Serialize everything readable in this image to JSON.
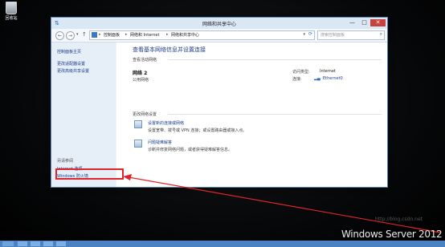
{
  "desktop": {
    "recycle_bin_label": "回收站",
    "watermark": "Windows Server 2012 R",
    "faint_text": "http://blog.csdn.net"
  },
  "window": {
    "title": "网络和共享中心",
    "minimize": "—",
    "maximize": "□",
    "close": "✕"
  },
  "address_bar": {
    "back": "←",
    "forward": "→",
    "history": "▾",
    "up": "↑",
    "breadcrumb": [
      "控制面板",
      "网络和 Internet",
      "网络和共享中心"
    ],
    "separator": "▸",
    "dropdown": "▾",
    "refresh": "⟳",
    "search_placeholder": "搜索控制面板",
    "search_icon": "⌕"
  },
  "sidebar": {
    "home": "控制面板主页",
    "change_adapter": "更改适配器设置",
    "change_advanced": "更改高级共享设置",
    "see_also": "另请参阅",
    "internet_options": "Internet 选项",
    "firewall": "Windows 防火墙"
  },
  "main": {
    "heading": "查看基本网络信息并设置连接",
    "active_networks_label": "查看活动网络",
    "network_name": "网络 2",
    "network_type": "公用网络",
    "access_type_label": "访问类型:",
    "access_type_value": "Internet",
    "connections_label": "连接:",
    "connection_value": "Ethernet0",
    "change_settings_label": "更改网络设置",
    "task1_link": "设置新的连接或网络",
    "task1_desc": "设置宽带、拨号或 VPN 连接；或设置路由器或接入点。",
    "task2_link": "问题疑难解答",
    "task2_desc": "诊断并修复网络问题，或者获得疑难解答信息。"
  },
  "colors": {
    "annotation": "#e0242b",
    "link": "#1a3e8c",
    "taskbar": "#4b82c3"
  }
}
